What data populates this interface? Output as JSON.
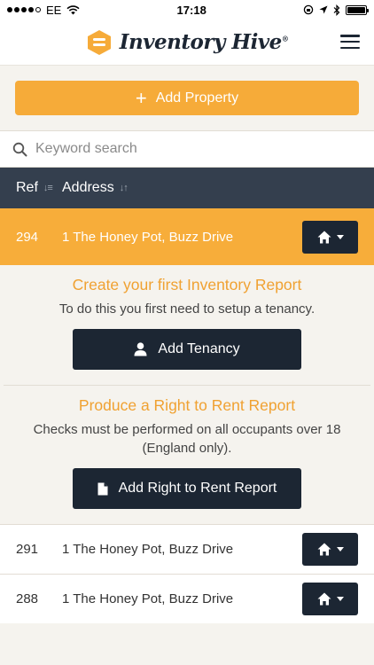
{
  "status_bar": {
    "carrier": "EE",
    "time": "17:18"
  },
  "header": {
    "brand_name": "Inventory Hive",
    "brand_mark": "®"
  },
  "actions": {
    "add_property_label": "Add Property"
  },
  "search": {
    "placeholder": "Keyword search",
    "value": ""
  },
  "table": {
    "columns": {
      "ref": "Ref",
      "address": "Address"
    }
  },
  "active_property": {
    "ref": "294",
    "address": "1 The Honey Pot, Buzz Drive"
  },
  "inventory_panel": {
    "title": "Create your first Inventory Report",
    "description": "To do this you first need to setup a tenancy.",
    "button_label": "Add Tenancy"
  },
  "rtr_panel": {
    "title": "Produce a Right to Rent Report",
    "description": "Checks must be performed on all occupants over 18 (England only).",
    "button_label": "Add Right to Rent Report"
  },
  "properties": [
    {
      "ref": "291",
      "address": "1 The Honey Pot, Buzz Drive"
    },
    {
      "ref": "288",
      "address": "1 The Honey Pot, Buzz Drive"
    }
  ],
  "colors": {
    "accent": "#f7ad3a",
    "dark": "#1c2633",
    "table_header": "#343f4e",
    "panel_title": "#f0a131",
    "background": "#f5f3ee"
  },
  "icons": {
    "menu": "hamburger-icon",
    "search": "search-icon",
    "home": "home-icon",
    "user": "user-icon",
    "document": "document-icon"
  }
}
